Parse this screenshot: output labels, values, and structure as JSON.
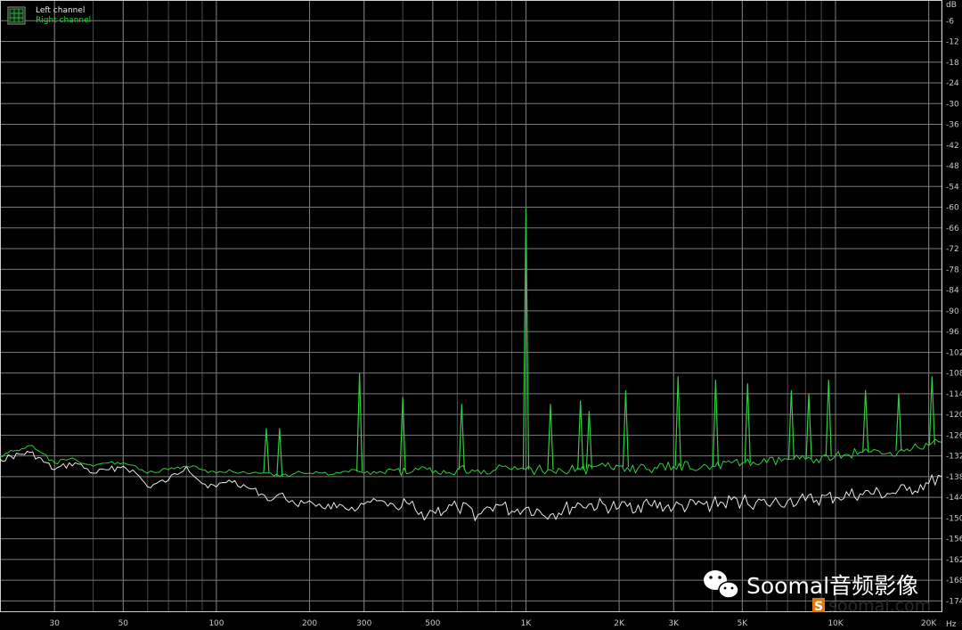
{
  "chart_data": {
    "type": "line",
    "x_scale": "log",
    "xlim": [
      20,
      22000
    ],
    "ylim": [
      -177,
      0
    ],
    "x_unit": "Hz",
    "y_unit": "dB",
    "grid": true,
    "legend_position": "top-left",
    "x_ticks": [
      {
        "value": 30,
        "label": "30"
      },
      {
        "value": 50,
        "label": "50"
      },
      {
        "value": 100,
        "label": "100"
      },
      {
        "value": 200,
        "label": "200"
      },
      {
        "value": 300,
        "label": "300"
      },
      {
        "value": 500,
        "label": "500"
      },
      {
        "value": 1000,
        "label": "1K"
      },
      {
        "value": 2000,
        "label": "2K"
      },
      {
        "value": 3000,
        "label": "3K"
      },
      {
        "value": 5000,
        "label": "5K"
      },
      {
        "value": 10000,
        "label": "10K"
      },
      {
        "value": 20000,
        "label": "20K"
      }
    ],
    "y_ticks": [
      -6,
      -12,
      -18,
      -24,
      -30,
      -36,
      -42,
      -48,
      -54,
      -60,
      -66,
      -72,
      -78,
      -84,
      -90,
      -96,
      -102,
      -108,
      -114,
      -120,
      -126,
      -132,
      -138,
      -144,
      -150,
      -156,
      -162,
      -168,
      -174
    ],
    "series": [
      {
        "name": "Left channel",
        "color": "#e8e8e8",
        "x": [
          20,
          25,
          30,
          35,
          40,
          45,
          50,
          55,
          60,
          70,
          80,
          90,
          100,
          110,
          125,
          140,
          150,
          160,
          180,
          200,
          220,
          250,
          280,
          300,
          330,
          380,
          420,
          450,
          500,
          600,
          700,
          800,
          900,
          1000,
          1200,
          1500,
          2000,
          2500,
          3000,
          4000,
          5000,
          6000,
          7000,
          8000,
          10000,
          12000,
          15000,
          17000,
          20000,
          22000
        ],
        "y": [
          -133,
          -131,
          -136,
          -134,
          -137,
          -136,
          -135,
          -137,
          -141,
          -139,
          -135,
          -140,
          -141,
          -139,
          -141,
          -143,
          -145,
          -143,
          -146,
          -145,
          -147,
          -146,
          -148,
          -146,
          -145,
          -147,
          -146,
          -149,
          -148,
          -147,
          -149,
          -146,
          -148,
          -147,
          -149,
          -146,
          -147,
          -146,
          -147,
          -146,
          -145,
          -146,
          -145,
          -145,
          -144,
          -143,
          -143,
          -142,
          -140,
          -138
        ]
      },
      {
        "name": "Right channel",
        "color": "#2ecc40",
        "x": [
          20,
          25,
          30,
          35,
          40,
          45,
          50,
          55,
          60,
          70,
          80,
          90,
          100,
          110,
          125,
          140,
          150,
          160,
          180,
          200,
          220,
          250,
          280,
          300,
          330,
          380,
          420,
          450,
          500,
          600,
          700,
          800,
          900,
          1000,
          1200,
          1500,
          2000,
          2500,
          3000,
          4000,
          5000,
          6000,
          7000,
          8000,
          10000,
          12000,
          15000,
          17000,
          20000,
          22000
        ],
        "y": [
          -132,
          -129,
          -134,
          -133,
          -135,
          -134,
          -134,
          -135,
          -137,
          -136,
          -135,
          -136,
          -137,
          -136,
          -137,
          -137,
          -137,
          -138,
          -137,
          -137,
          -137,
          -137,
          -136,
          -137,
          -137,
          -136,
          -137,
          -136,
          -137,
          -136,
          -136,
          -136,
          -136,
          -136,
          -136,
          -136,
          -135,
          -136,
          -135,
          -135,
          -134,
          -134,
          -133,
          -133,
          -132,
          -131,
          -131,
          -130,
          -129,
          -128
        ]
      }
    ],
    "peaks": [
      {
        "series": "Right channel",
        "x": 1000,
        "y": -60
      },
      {
        "series": "Right channel",
        "x": 290,
        "y": -108
      },
      {
        "series": "Right channel",
        "x": 400,
        "y": -115
      },
      {
        "series": "Right channel",
        "x": 620,
        "y": -117
      },
      {
        "series": "Right channel",
        "x": 145,
        "y": -124
      },
      {
        "series": "Right channel",
        "x": 160,
        "y": -124
      },
      {
        "series": "Right channel",
        "x": 1200,
        "y": -117
      },
      {
        "series": "Right channel",
        "x": 1500,
        "y": -116
      },
      {
        "series": "Right channel",
        "x": 1600,
        "y": -119
      },
      {
        "series": "Right channel",
        "x": 2100,
        "y": -113
      },
      {
        "series": "Right channel",
        "x": 3100,
        "y": -109
      },
      {
        "series": "Right channel",
        "x": 4100,
        "y": -110
      },
      {
        "series": "Right channel",
        "x": 5200,
        "y": -111
      },
      {
        "series": "Right channel",
        "x": 7200,
        "y": -113
      },
      {
        "series": "Right channel",
        "x": 8200,
        "y": -114
      },
      {
        "series": "Right channel",
        "x": 9500,
        "y": -110
      },
      {
        "series": "Right channel",
        "x": 12500,
        "y": -113
      },
      {
        "series": "Right channel",
        "x": 16000,
        "y": -114
      },
      {
        "series": "Right channel",
        "x": 20500,
        "y": -109
      }
    ]
  },
  "watermark": {
    "text": "Soomal音频影像",
    "sub": "soomal.com"
  }
}
